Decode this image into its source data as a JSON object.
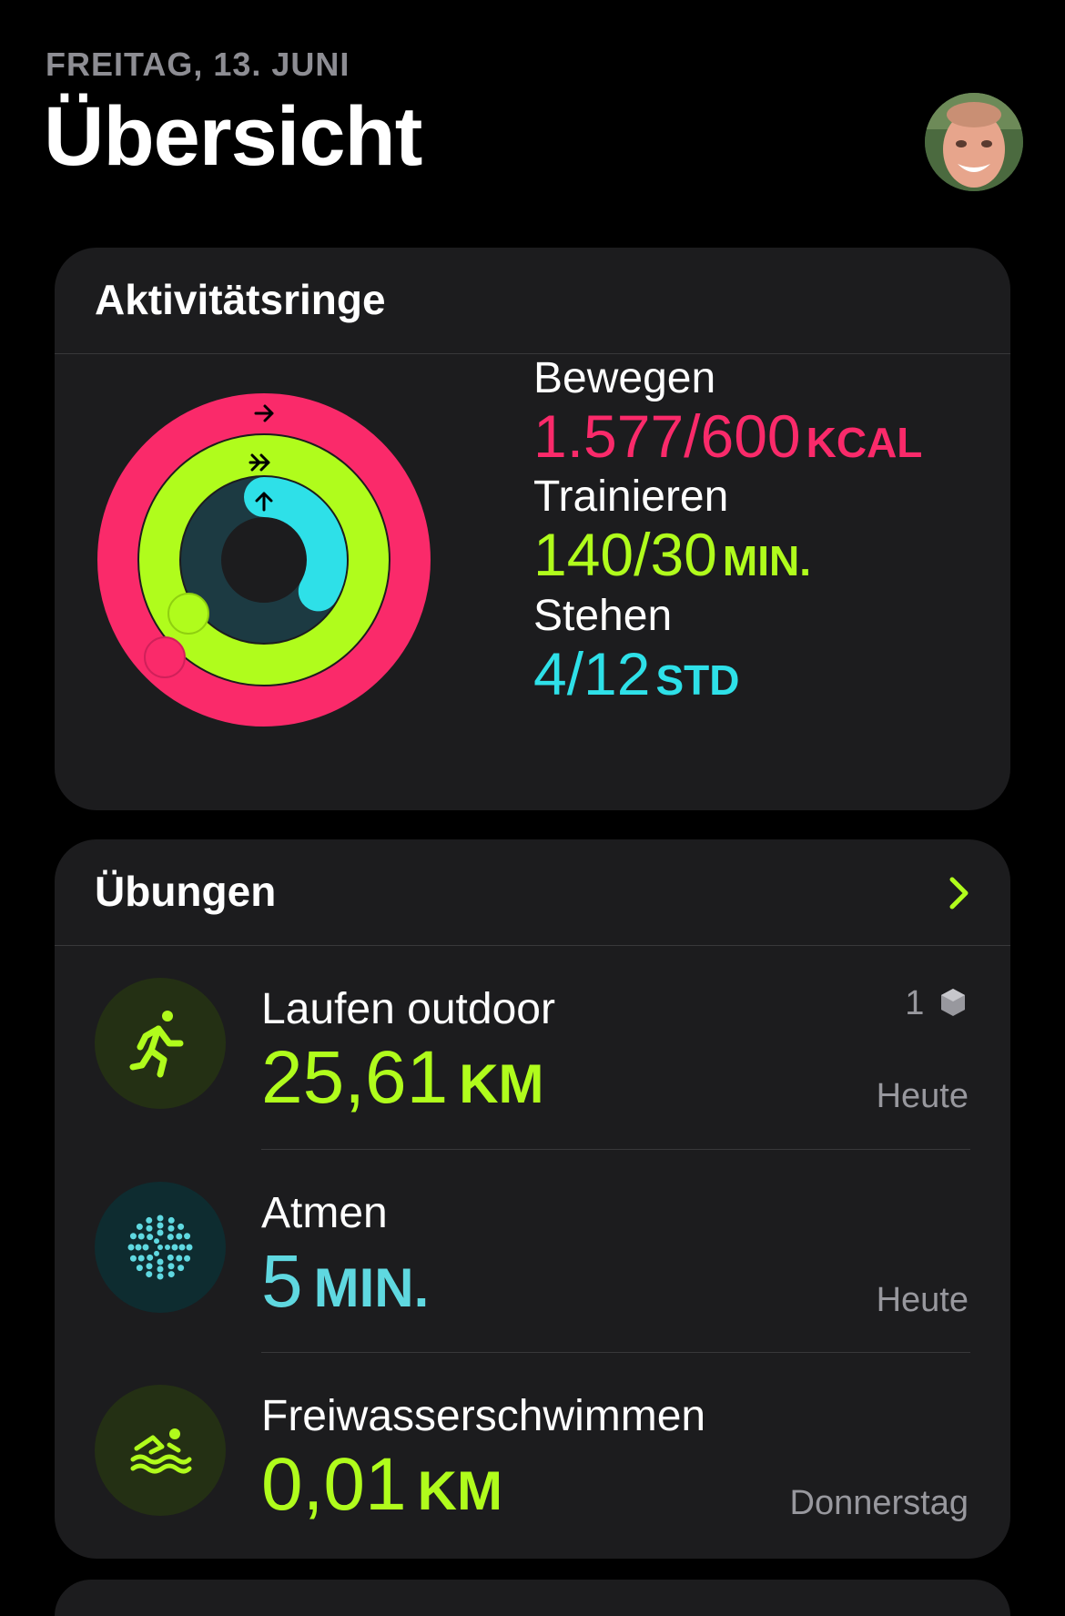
{
  "header": {
    "date": "FREITAG, 13. JUNI",
    "title": "Übersicht"
  },
  "rings": {
    "title": "Aktivitätsringe",
    "move": {
      "label": "Bewegen",
      "value": "1.577/600",
      "unit": "KCAL",
      "fraction": 2.63,
      "color": "#fa2a6a"
    },
    "exercise": {
      "label": "Trainieren",
      "value": "140/30",
      "unit": "MIN.",
      "fraction": 4.67,
      "color": "#b0fc1c"
    },
    "stand": {
      "label": "Stehen",
      "value": "4/12",
      "unit": "STD",
      "fraction": 0.333,
      "color": "#2ee0e8"
    }
  },
  "workouts": {
    "title": "Übungen",
    "items": [
      {
        "name": "Laufen outdoor",
        "value": "25,61",
        "unit": "KM",
        "when": "Heute",
        "badge": "1",
        "icon": "running-icon",
        "color": "#b0fc1c"
      },
      {
        "name": "Atmen",
        "value": "5",
        "unit": "MIN.",
        "when": "Heute",
        "icon": "breathe-icon",
        "color": "#5fd8e0"
      },
      {
        "name": "Freiwasserschwimmen",
        "value": "0,01",
        "unit": "KM",
        "when": "Donnerstag",
        "icon": "swimming-icon",
        "color": "#b0fc1c"
      }
    ]
  }
}
